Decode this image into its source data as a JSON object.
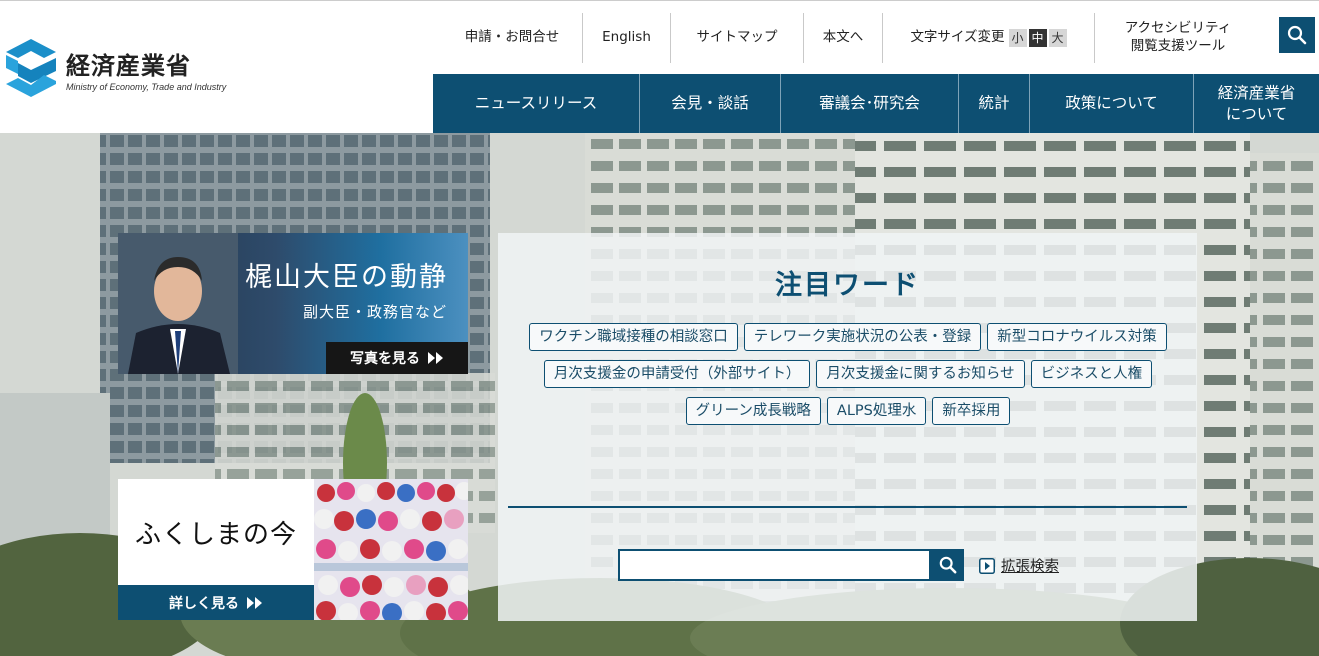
{
  "logo": {
    "jp": "経済産業省",
    "en": "Ministry of Economy, Trade and Industry"
  },
  "utility_nav": {
    "inquiry": "申請・お問合せ",
    "english": "English",
    "sitemap": "サイトマップ",
    "skip_to_main": "本文へ",
    "font_size_label": "文字サイズ変更",
    "font_size_small": "小",
    "font_size_medium": "中",
    "font_size_large": "大",
    "accessibility_line1": "アクセシビリティ",
    "accessibility_line2": "閲覧支援ツール"
  },
  "global_nav": {
    "items": [
      {
        "label": "ニュースリリース"
      },
      {
        "label": "会見・談話"
      },
      {
        "label": "審議会･研究会"
      },
      {
        "label": "統計"
      },
      {
        "label": "政策について"
      },
      {
        "label_line1": "経済産業省",
        "label_line2": "について"
      }
    ]
  },
  "minister_banner": {
    "title": "梶山大臣の動静",
    "subtitle": "副大臣・政務官など",
    "button": "写真を見る"
  },
  "fukushima_banner": {
    "title": "ふくしまの今",
    "button": "詳しく見る"
  },
  "attention": {
    "title": "注目ワード",
    "tags": [
      "ワクチン職域接種の相談窓口",
      "テレワーク実施状況の公表・登録",
      "新型コロナウイルス対策",
      "月次支援金の申請受付（外部サイト）",
      "月次支援金に関するお知らせ",
      "ビジネスと人権",
      "グリーン成長戦略",
      "ALPS処理水",
      "新卒採用"
    ]
  },
  "search": {
    "value": "",
    "advanced_label": "拡張検索"
  },
  "colors": {
    "brand": "#0d4f72",
    "logo_blue": "#1b8fc9"
  }
}
